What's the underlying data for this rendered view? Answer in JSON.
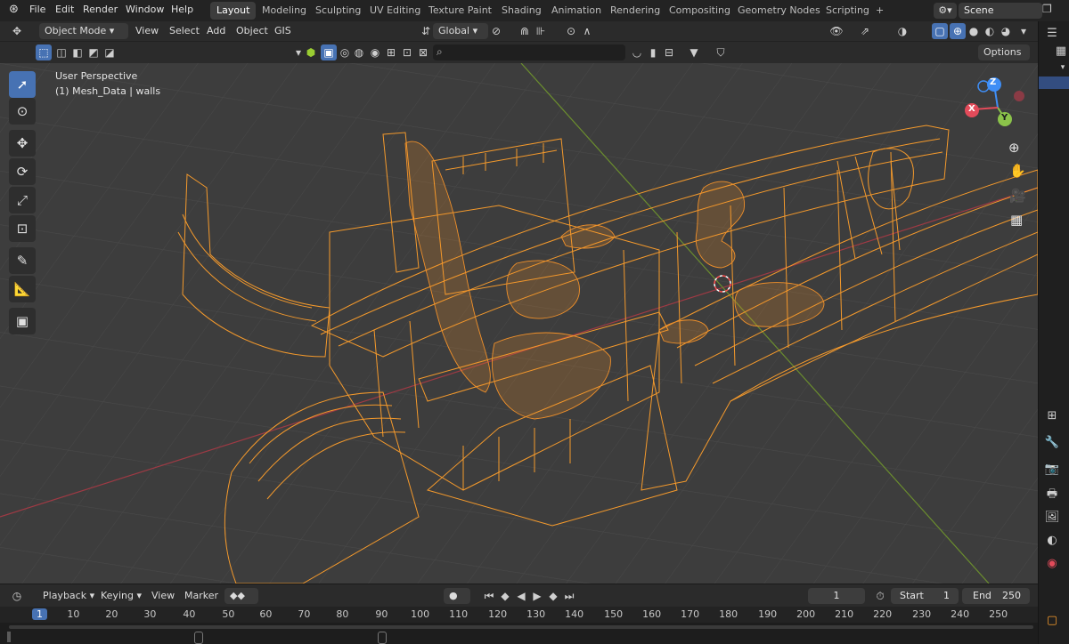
{
  "menu": [
    "File",
    "Edit",
    "Render",
    "Window",
    "Help"
  ],
  "workspaces": [
    "Layout",
    "Modeling",
    "Sculpting",
    "UV Editing",
    "Texture Paint",
    "Shading",
    "Animation",
    "Rendering",
    "Compositing",
    "Geometry Nodes",
    "Scripting",
    "+"
  ],
  "active_workspace": "Layout",
  "scene_name": "Scene",
  "header": {
    "mode": "Object Mode",
    "view": "View",
    "select": "Select",
    "add": "Add",
    "object": "Object",
    "gis": "GIS",
    "transform_orientation": "Global",
    "options": "Options"
  },
  "viewport": {
    "perspective_label": "User Perspective",
    "object_label": "(1) Mesh_Data | walls",
    "gizmo": {
      "x": "X",
      "y": "Y",
      "z": "Z"
    },
    "wire_color": "#f59a2c"
  },
  "timeline": {
    "playback": "Playback",
    "keying": "Keying",
    "view": "View",
    "marker": "Marker",
    "current_frame": "1",
    "start_label": "Start",
    "start": "1",
    "end_label": "End",
    "end": "250",
    "ruler_ticks": [
      "1",
      "10",
      "20",
      "30",
      "40",
      "50",
      "60",
      "70",
      "80",
      "90",
      "100",
      "110",
      "120",
      "130",
      "140",
      "150",
      "160",
      "170",
      "180",
      "190",
      "200",
      "210",
      "220",
      "230",
      "240",
      "250"
    ]
  },
  "colors": {
    "accent": "#4772b3",
    "axis_x": "#e34b5a",
    "axis_y": "#8bc34a",
    "axis_z": "#3f8ef5"
  }
}
